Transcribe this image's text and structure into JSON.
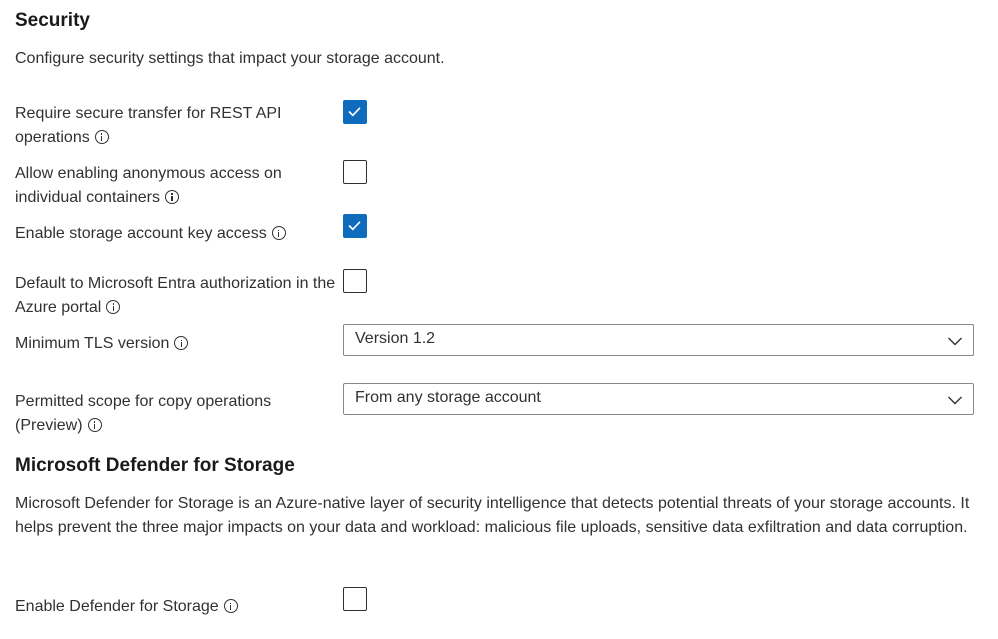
{
  "security": {
    "heading": "Security",
    "description": "Configure security settings that impact your storage account.",
    "settings": [
      {
        "label": "Require secure transfer for REST API operations",
        "checked": true
      },
      {
        "label": "Allow enabling anonymous access on individual containers",
        "checked": false
      },
      {
        "label": "Enable storage account key access",
        "checked": true
      },
      {
        "label": "Default to Microsoft Entra authorization in the Azure portal",
        "checked": false
      }
    ],
    "tls": {
      "label": "Minimum TLS version",
      "value": "Version 1.2"
    },
    "copy_scope": {
      "label": "Permitted scope for copy operations (Preview)",
      "value": "From any storage account"
    }
  },
  "defender": {
    "heading": "Microsoft Defender for Storage",
    "description": "Microsoft Defender for Storage is an Azure-native layer of security intelligence that detects potential threats of your storage accounts. It helps prevent the three major impacts on your data and workload: malicious file uploads, sensitive data exfiltration and data corruption.",
    "enable": {
      "label": "Enable Defender for Storage",
      "checked": false
    }
  },
  "icons": {
    "info": "info-icon",
    "checkmark": "checkmark-icon",
    "dropdown": "chevron-down-icon"
  },
  "colors": {
    "checkbox_checked": "#0f6cbd",
    "text": "#323130",
    "border": "#8a8886"
  }
}
